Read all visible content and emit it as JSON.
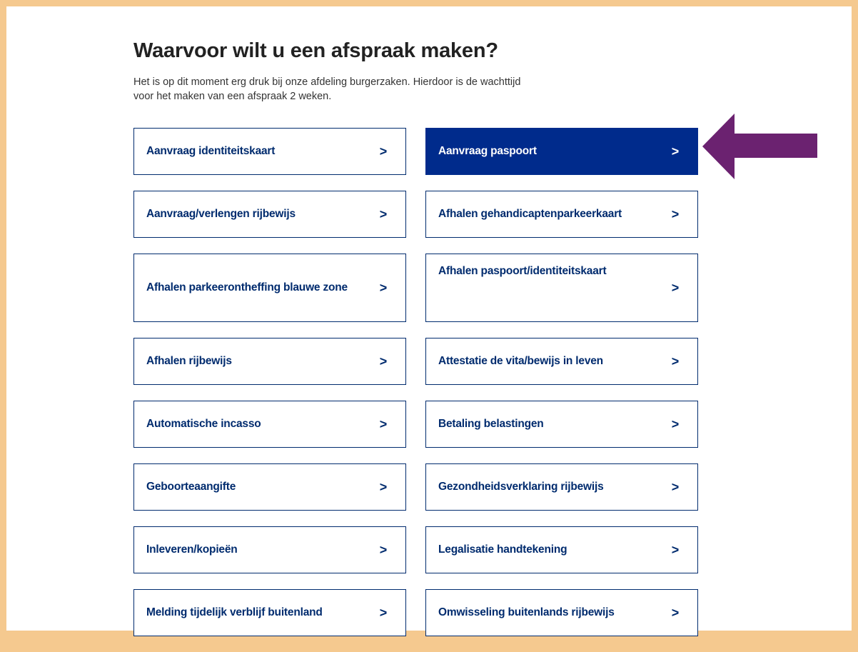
{
  "page": {
    "title": "Waarvoor wilt u een afspraak maken?",
    "intro": "Het is op dit moment erg druk bij onze afdeling burgerzaken. Hierdoor is de wachttijd voor het maken van een afspraak 2 weken."
  },
  "options": [
    {
      "label": "Aanvraag identiteitskaart",
      "chevron": ">"
    },
    {
      "label": "Aanvraag paspoort",
      "chevron": ">"
    },
    {
      "label": "Aanvraag/verlengen rijbewijs",
      "chevron": ">"
    },
    {
      "label": "Afhalen gehandicaptenparkeerkaart",
      "chevron": ">"
    },
    {
      "label": "Afhalen parkeerontheffing blauwe zone",
      "chevron": ">"
    },
    {
      "label": "Afhalen paspoort/identiteitskaart",
      "chevron": ">"
    },
    {
      "label": "Afhalen rijbewijs",
      "chevron": ">"
    },
    {
      "label": "Attestatie de vita/bewijs in leven",
      "chevron": ">"
    },
    {
      "label": "Automatische incasso",
      "chevron": ">"
    },
    {
      "label": "Betaling belastingen",
      "chevron": ">"
    },
    {
      "label": "Geboorteaangifte",
      "chevron": ">"
    },
    {
      "label": "Gezondheidsverklaring rijbewijs",
      "chevron": ">"
    },
    {
      "label": "Inleveren/kopieën",
      "chevron": ">"
    },
    {
      "label": "Legalisatie handtekening",
      "chevron": ">"
    },
    {
      "label": "Melding tijdelijk verblijf buitenland",
      "chevron": ">"
    },
    {
      "label": "Omwisseling buitenlands rijbewijs",
      "chevron": ">"
    }
  ],
  "colors": {
    "frame": "#f5c98f",
    "primary": "#002b6e",
    "active": "#002b8c",
    "annotation_arrow": "#6b2270"
  },
  "annotation": {
    "icon": "arrow-left-icon",
    "points_to": "Aanvraag paspoort"
  }
}
